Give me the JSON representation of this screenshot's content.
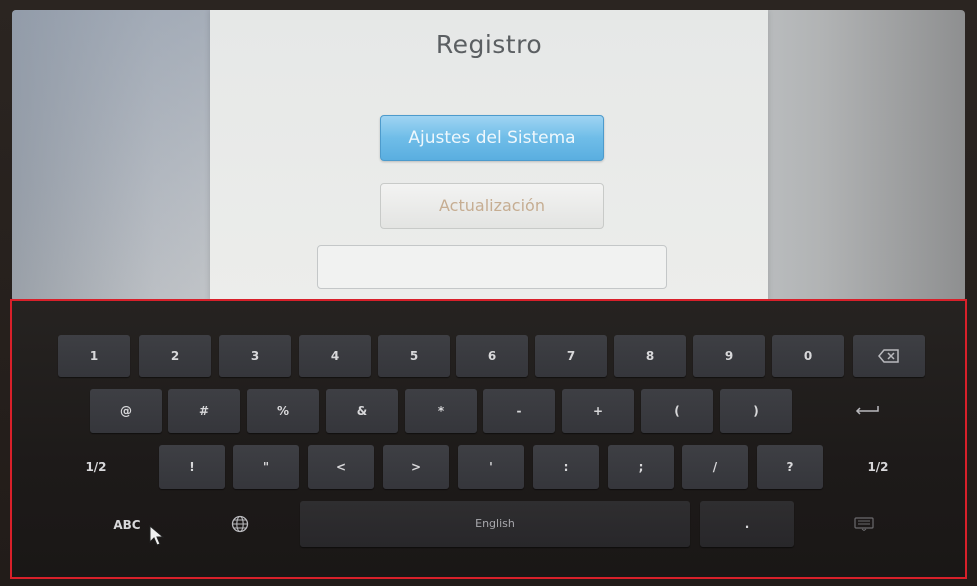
{
  "app": {
    "title": "Registro",
    "system_settings_button": "Ajustes del Sistema",
    "update_button": "Actualización",
    "input_value": ""
  },
  "keyboard": {
    "row1": [
      "1",
      "2",
      "3",
      "4",
      "5",
      "6",
      "7",
      "8",
      "9",
      "0"
    ],
    "row2": [
      "@",
      "#",
      "%",
      "&",
      "*",
      "-",
      "+",
      "(",
      ")"
    ],
    "row3_left": "1/2",
    "row3": [
      "!",
      "\"",
      "<",
      ">",
      "'",
      ":",
      ";",
      "/",
      "?"
    ],
    "row3_right": "1/2",
    "abc_label": "ABC",
    "space_label": "English",
    "period_label": ".",
    "icons": {
      "backspace": "backspace-icon",
      "enter": "enter-icon",
      "globe": "globe-icon",
      "hide": "keyboard-hide-icon",
      "cursor": "mouse-cursor-icon"
    },
    "highlight_color": "#d8202a"
  }
}
